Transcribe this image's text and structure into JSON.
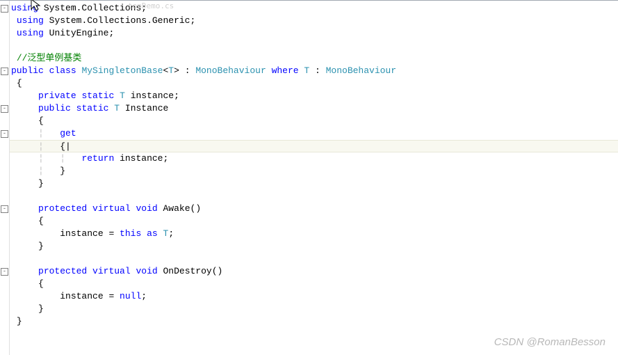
{
  "tab_ghost": "tonDemo.cs",
  "watermark": "CSDN @RomanBesson",
  "fold_markers": {
    "l1": "-",
    "l7": "-",
    "l10": "-",
    "l12": "-",
    "l18": "-",
    "l24": "-"
  },
  "code": {
    "using": "using",
    "ns1": "System.Collections",
    "ns2": "System.Collections.Generic",
    "ns3": "UnityEngine",
    "semi": ";",
    "comment1": "//泛型单例基类",
    "public": "public",
    "class": "class",
    "classname": "MySingletonBase",
    "lt": "<",
    "gt": ">",
    "T": "T",
    "colon": " : ",
    "mono": "MonoBehaviour",
    "where": "where",
    "typeConstraint": " : ",
    "lbrace": "{",
    "rbrace": "}",
    "private": "private",
    "static": "static",
    "instance_field": "instance",
    "Instance_prop": "Instance",
    "get": "get",
    "return": "return",
    "protected": "protected",
    "virtual": "virtual",
    "void": "void",
    "Awake": "Awake",
    "OnDestroy": "OnDestroy",
    "parens": "()",
    "this": "this",
    "as": "as",
    "equals": " = ",
    "null": "null",
    "pipe": "{|"
  }
}
